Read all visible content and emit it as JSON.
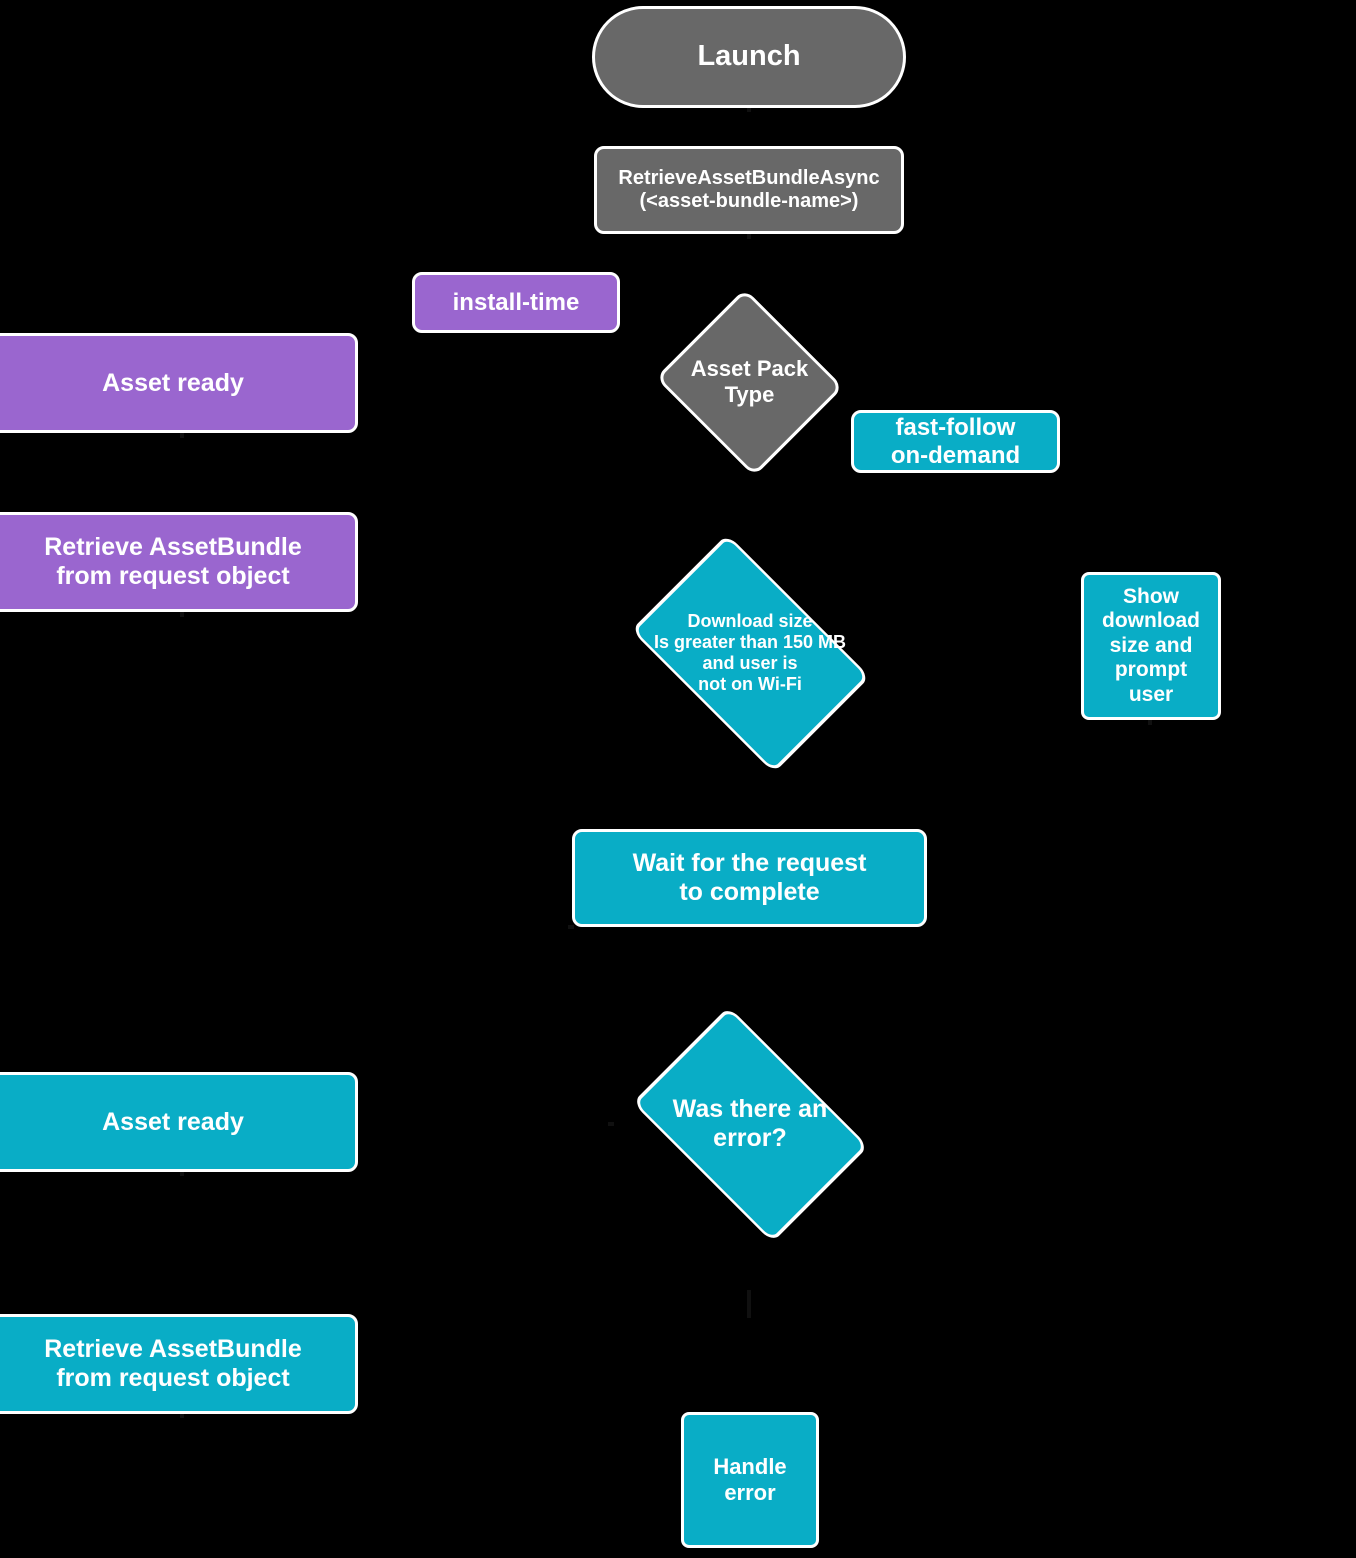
{
  "diagram": {
    "title": "Asset pack delivery flow",
    "background_color": "#000000",
    "palette": {
      "gray": "#686868",
      "purple": "#9a66cf",
      "teal": "#09adc6",
      "stroke": "#ffffff",
      "text": "#ffffff"
    }
  },
  "nodes": {
    "launch": {
      "label": "Launch",
      "shape": "pill",
      "color": "#686868"
    },
    "retrieve_async": {
      "label": "RetrieveAssetBundleAsync\n(<asset-bundle-name>)",
      "shape": "rounded-rect",
      "color": "#686868"
    },
    "install_time_label": {
      "label": "install-time",
      "shape": "rounded-rect",
      "color": "#9a66cf"
    },
    "asset_pack_type": {
      "label": "Asset Pack\nType",
      "shape": "diamond",
      "color": "#686868"
    },
    "fast_follow_label": {
      "label": "fast-follow\non-demand",
      "shape": "rounded-rect",
      "color": "#09adc6"
    },
    "asset_ready_purple": {
      "label": "Asset ready",
      "shape": "rounded-rect",
      "color": "#9a66cf"
    },
    "retrieve_bundle_purple": {
      "label": "Retrieve AssetBundle\nfrom request object",
      "shape": "rounded-rect",
      "color": "#9a66cf"
    },
    "download_size_check": {
      "label": "Download size\nIs greater than 150 MB\nand user is\nnot on Wi-Fi",
      "shape": "diamond",
      "color": "#09adc6"
    },
    "show_download_prompt": {
      "label": "Show\ndownload\nsize and\nprompt\nuser",
      "shape": "rounded-rect",
      "color": "#09adc6"
    },
    "wait_for_request": {
      "label": "Wait for the request\nto complete",
      "shape": "rounded-rect",
      "color": "#09adc6"
    },
    "was_there_error": {
      "label": "Was there an\nerror?",
      "shape": "diamond",
      "color": "#09adc6"
    },
    "asset_ready_teal": {
      "label": "Asset ready",
      "shape": "rounded-rect",
      "color": "#09adc6"
    },
    "retrieve_bundle_teal": {
      "label": "Retrieve AssetBundle\nfrom request object",
      "shape": "rounded-rect",
      "color": "#09adc6"
    },
    "handle_error": {
      "label": "Handle\nerror",
      "shape": "rounded-rect",
      "color": "#09adc6"
    }
  }
}
